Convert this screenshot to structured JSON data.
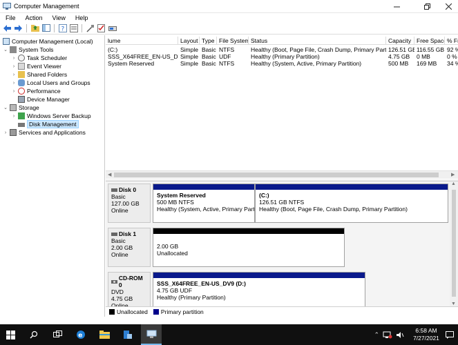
{
  "window": {
    "title": "Computer Management",
    "controls": [
      "minimize",
      "restore",
      "close"
    ]
  },
  "menu": [
    "File",
    "Action",
    "View",
    "Help"
  ],
  "toolbar": {
    "icons": [
      "back-icon",
      "forward-icon",
      "up-folder-icon",
      "show-hide-console-tree-icon",
      "help-icon",
      "properties-icon",
      "connect-disk-icon",
      "checklist-icon",
      "volume-icon"
    ]
  },
  "tree": {
    "root": "Computer Management (Local)",
    "system_tools": "System Tools",
    "task_scheduler": "Task Scheduler",
    "event_viewer": "Event Viewer",
    "shared_folders": "Shared Folders",
    "local_users": "Local Users and Groups",
    "performance": "Performance",
    "device_manager": "Device Manager",
    "storage": "Storage",
    "wsb": "Windows Server Backup",
    "disk_management": "Disk Management",
    "services": "Services and Applications"
  },
  "volumes": {
    "columns": [
      "lume",
      "Layout",
      "Type",
      "File System",
      "Status",
      "Capacity",
      "Free Space",
      "% Fr"
    ],
    "rows": [
      [
        "(C:)",
        "Simple",
        "Basic",
        "NTFS",
        "Healthy (Boot, Page File, Crash Dump, Primary Partition)",
        "126.51 GB",
        "116.55 GB",
        "92 %"
      ],
      [
        "SSS_X64FREE_EN-US_DV9 (D:)",
        "Simple",
        "Basic",
        "UDF",
        "Healthy (Primary Partition)",
        "4.75 GB",
        "0 MB",
        "0 %"
      ],
      [
        "System Reserved",
        "Simple",
        "Basic",
        "NTFS",
        "Healthy (System, Active, Primary Partition)",
        "500 MB",
        "169 MB",
        "34 %"
      ]
    ]
  },
  "disks": {
    "disk0": {
      "name": "Disk 0",
      "type": "Basic",
      "size": "127.00 GB",
      "state": "Online",
      "p1": {
        "name": "System Reserved",
        "size": "500 MB NTFS",
        "status": "Healthy (System, Active, Primary Partitio"
      },
      "p2": {
        "name": "(C:)",
        "size": "126.51 GB NTFS",
        "status": "Healthy (Boot, Page File, Crash Dump, Primary Partition)"
      }
    },
    "disk1": {
      "name": "Disk 1",
      "type": "Basic",
      "size": "2.00 GB",
      "state": "Online",
      "p1": {
        "size": "2.00 GB",
        "status": "Unallocated"
      }
    },
    "cdrom0": {
      "name": "CD-ROM 0",
      "type": "DVD",
      "size": "4.75 GB",
      "state": "Online",
      "p1": {
        "name": "SSS_X64FREE_EN-US_DV9  (D:)",
        "size": "4.75 GB UDF",
        "status": "Healthy (Primary Partition)"
      }
    }
  },
  "legend": {
    "unallocated": "Unallocated",
    "primary": "Primary partition",
    "unallocated_color": "#000000",
    "primary_color": "#00008b"
  },
  "colors": {
    "primary_bar": "#0a1a8c",
    "unallocated_bar": "#000000",
    "selection": "#cce8ff"
  },
  "taskbar": {
    "time": "6:58 AM",
    "date": "7/27/2021",
    "icons": [
      "start-icon",
      "search-icon",
      "task-view-icon",
      "edge-icon",
      "file-explorer-icon",
      "server-manager-icon",
      "computer-management-icon"
    ]
  }
}
